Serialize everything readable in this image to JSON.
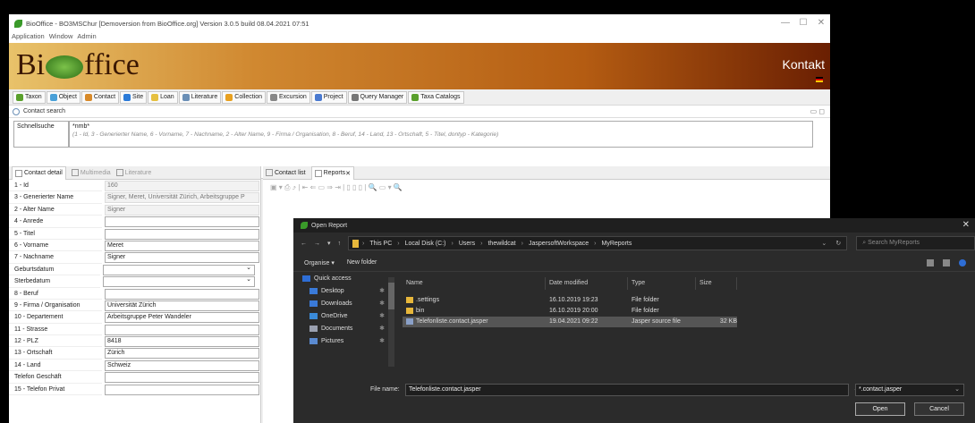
{
  "window": {
    "title": "BioOffice - BO3MSChur [Demoversion from BioOffice.org] Version 3.0.5 build 08.04.2021 07:51",
    "controls": [
      "—",
      "☐",
      "✕"
    ]
  },
  "menu": [
    "Application",
    "Window",
    "Admin"
  ],
  "banner": {
    "logo_left": "Bi",
    "logo_right": "ffice",
    "title": "Kontakt"
  },
  "toolbar": [
    {
      "label": "Taxon",
      "color": "#5aa02c"
    },
    {
      "label": "Object",
      "color": "#4aa0d8"
    },
    {
      "label": "Contact",
      "color": "#d88a2a"
    },
    {
      "label": "Site",
      "color": "#2a7ad8"
    },
    {
      "label": "Loan",
      "color": "#e6c040"
    },
    {
      "label": "Literature",
      "color": "#6a8fb6"
    },
    {
      "label": "Collection",
      "color": "#e8a020"
    },
    {
      "label": "Excursion",
      "color": "#888888"
    },
    {
      "label": "Project",
      "color": "#4a7ad0"
    },
    {
      "label": "Query Manager",
      "color": "#777777"
    },
    {
      "label": "Taxa Catalogs",
      "color": "#5aa02c"
    }
  ],
  "contact_search": {
    "title": "Contact search",
    "label": "Schnellsuche",
    "value": "*nmb*",
    "hint": "(1 - Id, 3 - Generierter Name, 6 - Vorname, 7 - Nachname, 2 - Alter Name, 9 - Firma / Organisation, 8 - Beruf, 14 - Land, 13 - Ortschaft, 5 - Titel, dontyp - Kategorie)"
  },
  "left_tabs": [
    "Contact detail",
    "Multimedia",
    "Literature"
  ],
  "fields": [
    {
      "label": "1 - Id",
      "value": "160",
      "ro": true
    },
    {
      "label": "3 - Generierter Name",
      "value": "Signer, Meret, Universität Zürich, Arbeitsgruppe P",
      "ro": true
    },
    {
      "label": "2 - Alter Name",
      "value": "Signer",
      "ro": true
    },
    {
      "label": "4 - Anrede",
      "value": ""
    },
    {
      "label": "5 - Titel",
      "value": ""
    },
    {
      "label": "6 - Vorname",
      "value": "Meret"
    },
    {
      "label": "7 - Nachname",
      "value": "Signer"
    },
    {
      "label": "Geburtsdatum",
      "value": "",
      "dd": true
    },
    {
      "label": "Sterbedatum",
      "value": "",
      "dd": true
    },
    {
      "label": "8 - Beruf",
      "value": ""
    },
    {
      "label": "9 - Firma / Organisation",
      "value": "Universität Zürich"
    },
    {
      "label": "10 - Departement",
      "value": "Arbeitsgruppe Peter Wandeler"
    },
    {
      "label": "11 - Strasse",
      "value": ""
    },
    {
      "label": "12 - PLZ",
      "value": "8418"
    },
    {
      "label": "13 - Ortschaft",
      "value": "Zürich"
    },
    {
      "label": "14 - Land",
      "value": "Schweiz"
    },
    {
      "label": "Telefon Geschäft",
      "value": ""
    },
    {
      "label": "15 - Telefon Privat",
      "value": ""
    }
  ],
  "right_tabs": [
    "Contact list",
    "Reports"
  ],
  "dialog": {
    "title": "Open Report",
    "path": [
      "This PC",
      "Local Disk (C:)",
      "Users",
      "thewildcat",
      "JaspersoftWorkspace",
      "MyReports"
    ],
    "search_placeholder": "Search MyReports",
    "organise": "Organise ▾",
    "new_folder": "New folder",
    "nav": [
      {
        "label": "Quick access",
        "color": "#2e6ed6"
      },
      {
        "label": "Desktop",
        "color": "#3a7ad8"
      },
      {
        "label": "Downloads",
        "color": "#3a7ad8"
      },
      {
        "label": "OneDrive",
        "color": "#3a8ad8"
      },
      {
        "label": "Documents",
        "color": "#9aa0b0"
      },
      {
        "label": "Pictures",
        "color": "#5a8ad0"
      }
    ],
    "columns": [
      "Name",
      "Date modified",
      "Type",
      "Size"
    ],
    "files": [
      {
        "name": ".settings",
        "date": "16.10.2019 19:23",
        "type": "File folder",
        "size": ""
      },
      {
        "name": "bin",
        "date": "16.10.2019 20:00",
        "type": "File folder",
        "size": ""
      },
      {
        "name": "Telefonliste.contact.jasper",
        "date": "19.04.2021 09:22",
        "type": "Jasper source file",
        "size": "32 KB"
      }
    ],
    "file_name_label": "File name:",
    "file_name": "Telefonliste.contact.jasper",
    "file_type": "*.contact.jasper",
    "open": "Open",
    "cancel": "Cancel"
  }
}
